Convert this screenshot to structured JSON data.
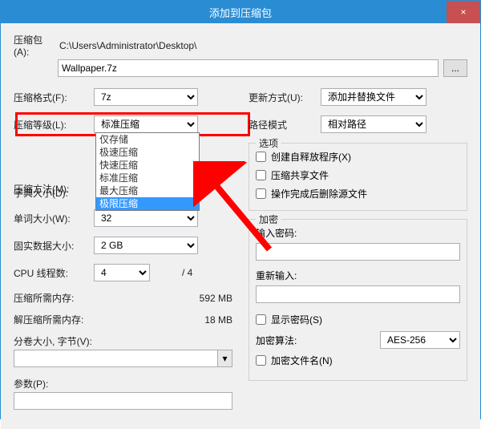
{
  "title": "添加到压缩包",
  "close": "×",
  "archive": {
    "label": "压缩包(A):",
    "path": "C:\\Users\\Administrator\\Desktop\\",
    "filename": "Wallpaper.7z",
    "browse": "..."
  },
  "left": {
    "format": {
      "label": "压缩格式(F):",
      "value": "7z"
    },
    "level": {
      "label": "压缩等级(L):",
      "value": "标准压缩",
      "options": [
        "仅存储",
        "极速压缩",
        "快速压缩",
        "标准压缩",
        "最大压缩",
        "极限压缩"
      ]
    },
    "method": {
      "label": "压缩方法(M):",
      "value": ""
    },
    "dict": {
      "label": "字典大小(D):",
      "value": ""
    },
    "word": {
      "label": "单词大小(W):",
      "value": "32"
    },
    "solid": {
      "label": "固实数据大小:",
      "value": "2 GB"
    },
    "cpu": {
      "label": "CPU 线程数:",
      "value": "4",
      "total": "/ 4"
    },
    "mem_comp": {
      "label": "压缩所需内存:",
      "value": "592 MB"
    },
    "mem_decomp": {
      "label": "解压缩所需内存:",
      "value": "18 MB"
    },
    "split": {
      "label": "分卷大小, 字节(V):"
    },
    "params": {
      "label": "参数(P):"
    }
  },
  "right": {
    "update": {
      "label": "更新方式(U):",
      "value": "添加并替换文件"
    },
    "pathmode": {
      "label": "路径模式",
      "value": "相对路径"
    },
    "options": {
      "title": "选项",
      "sfx": "创建自释放程序(X)",
      "share": "压缩共享文件",
      "delete": "操作完成后删除源文件"
    },
    "encrypt": {
      "title": "加密",
      "pwd": "输入密码:",
      "pwd2": "重新输入:",
      "show": "显示密码(S)",
      "algo_label": "加密算法:",
      "algo": "AES-256",
      "encnames": "加密文件名(N)"
    }
  }
}
